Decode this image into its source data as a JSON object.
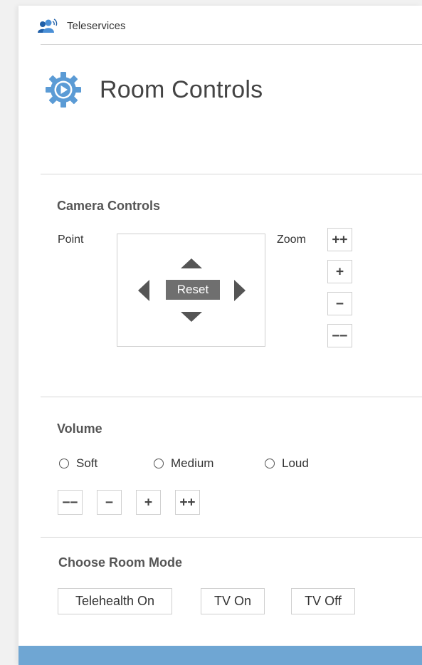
{
  "app": {
    "name": "Teleservices",
    "icon": "users-broadcast-icon"
  },
  "page": {
    "title": "Room Controls",
    "icon": "gear-play-icon",
    "accent_color": "#5b9bd5"
  },
  "camera": {
    "section_title": "Camera Controls",
    "point_label": "Point",
    "zoom_label": "Zoom",
    "reset_label": "Reset",
    "zoom_buttons": [
      "++",
      "+",
      "−",
      "−−"
    ]
  },
  "volume": {
    "section_title": "Volume",
    "options": [
      "Soft",
      "Medium",
      "Loud"
    ],
    "selected": null,
    "buttons": [
      "−−",
      "−",
      "+",
      "++"
    ]
  },
  "room_mode": {
    "section_title": "Choose Room Mode",
    "buttons": [
      "Telehealth On",
      "TV On",
      "TV Off"
    ]
  },
  "footer": {
    "color": "#6fa6d3"
  }
}
